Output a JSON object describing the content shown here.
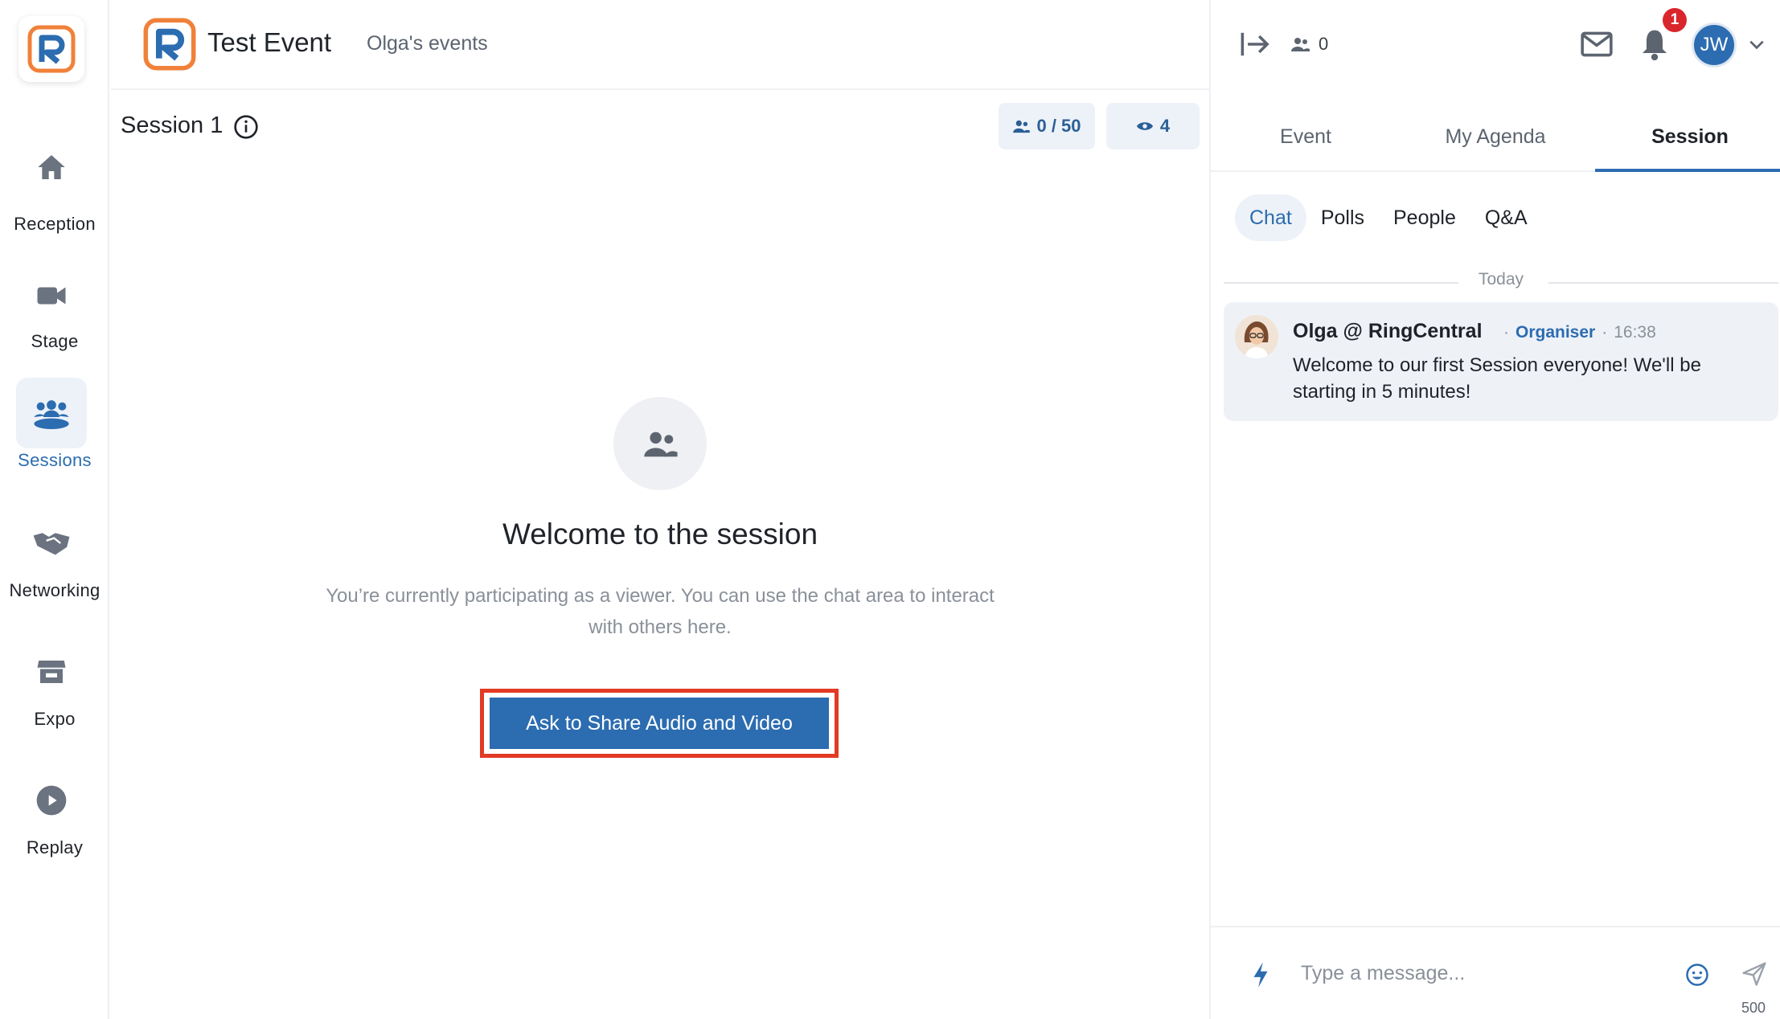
{
  "app": {
    "event_title": "Test Event",
    "organizer": "Olga's events"
  },
  "nav": {
    "items": [
      {
        "label": "Reception",
        "icon": "home-icon"
      },
      {
        "label": "Stage",
        "icon": "video-camera-icon"
      },
      {
        "label": "Sessions",
        "icon": "group-icon",
        "active": true
      },
      {
        "label": "Networking",
        "icon": "handshake-icon"
      },
      {
        "label": "Expo",
        "icon": "store-icon"
      },
      {
        "label": "Replay",
        "icon": "play-icon"
      }
    ]
  },
  "session": {
    "title": "Session 1",
    "capacity": "0 / 50",
    "viewers": "4"
  },
  "main": {
    "welcome_title": "Welcome to the session",
    "welcome_text": "You’re currently participating as a viewer. You can use the chat area to interact with others here.",
    "ask_button": "Ask to Share Audio and Video"
  },
  "right": {
    "online_count": "0",
    "notification_count": "1",
    "user_initials": "JW",
    "tabs": [
      "Event",
      "My Agenda",
      "Session"
    ],
    "active_tab": "Session",
    "subtabs": [
      "Chat",
      "Polls",
      "People",
      "Q&A"
    ],
    "active_subtab": "Chat",
    "day_divider": "Today",
    "message": {
      "author": "Olga @ RingCentral",
      "role": "Organiser",
      "time": "16:38",
      "text": "Welcome to our first Session everyone! We'll be starting in 5 minutes!"
    },
    "composer": {
      "placeholder": "Type a message...",
      "char_limit": "500"
    }
  },
  "colors": {
    "accent": "#2c6cb0",
    "highlight_border": "#e23a24",
    "badge": "#d9262c",
    "brand_orange": "#f0813a"
  }
}
